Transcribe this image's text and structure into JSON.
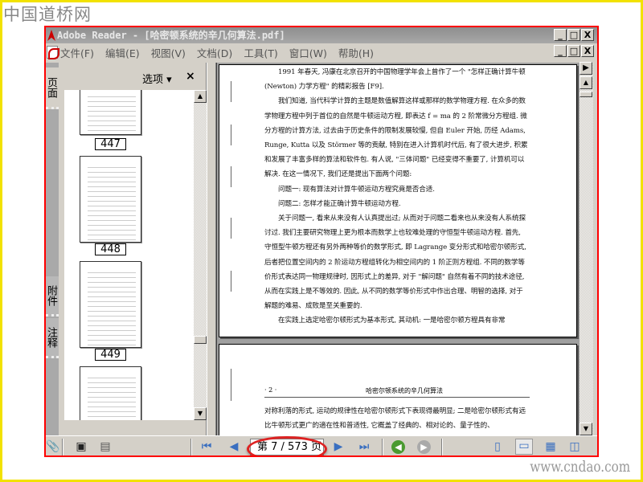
{
  "watermark_top": "中国道桥网",
  "watermark_bottom": "www.cndao.com",
  "window": {
    "title": "Adobe Reader - [哈密顿系统的辛几何算法.pdf]",
    "min": "_",
    "max": "□",
    "close": "X",
    "restore": "🗗"
  },
  "menu": [
    "文件(F)",
    "编辑(E)",
    "视图(V)",
    "文档(D)",
    "工具(T)",
    "窗口(W)",
    "帮助(H)"
  ],
  "side_tabs": [
    "页面",
    "附件",
    "注释"
  ],
  "panel": {
    "options_label": "选项 ▾",
    "close": "×",
    "thumbnails": [
      "447",
      "448",
      "449",
      ""
    ]
  },
  "page1": {
    "paragraphs": [
      "1991 年春天, 冯康在北京召开的中国物理学年会上曾作了一个 \"怎样正确计算牛顿 (Newton) 力学方程\" 的精彩报告 [F9].",
      "我们知道, 当代科学计算的主题是数值解算这样或那样的数学物理方程. 在众多的数学物理方程中列于首位的自然是牛顿运动方程, 即表达 f = ma 的 2 阶常微分方程组. 微分方程的计算方法, 过去由于历史条件的限制发展较慢, 但自 Euler 开始, 历经 Adams, Runge, Kutta 以及 Störmer 等的贡献, 特别在进入计算机时代后, 有了很大进步, 积累和发展了丰富多样的算法和软件包. 有人说, \"三体问题\" 已经变得不重要了, 计算机可以解决. 在这一情况下, 我们还是提出下面两个问题:",
      "问题一: 现有算法对计算牛顿运动方程究竟是否合适.",
      "问题二: 怎样才能正确计算牛顿运动方程.",
      "关于问题一, 看来从来没有人认真提出过; 从而对于问题二看来也从来没有人系统探讨过. 我们主要研究物理上更为根本而数学上也较难处理的守恒型牛顿运动方程. 首先, 守恒型牛顿方程还有另外两种等价的数学形式, 即 Lagrange 变分形式和哈密尔顿形式, 后者把位置空间内的 2 阶运动方程组转化为相空间内的 1 阶正则方程组. 不同的数学等价形式表达同一物理规律时, 因形式上的差异, 对于 \"解问题\" 自然有着不同的技术途径, 从而在实践上是不等效的. 因此, 从不同的数学等价形式中作出合理、明智的选择, 对于解题的难易、成败是至关重要的.",
      "在实践上选定哈密尔顿形式为基本形式, 其动机: 一是哈密尔顿方程具有非常"
    ]
  },
  "page2": {
    "page_number": "· 2 ·",
    "running_head": "哈密尔顿系统的辛几何算法",
    "text": "对称利落的形式, 运动的规律性在哈密尔顿形式下表现得最明显; 二是哈密尔顿形式有远比牛顿形式更广的適在性和普适性, 它概盖了经典的、相对论的、量子性的、"
  },
  "nav": {
    "page_display": "第 7 / 573 页",
    "current_page": 7,
    "total_pages": 573
  },
  "colors": {
    "highlight_ellipse": "#dd2222",
    "frame": "#ff0000",
    "outer_border": "#f2e200"
  }
}
